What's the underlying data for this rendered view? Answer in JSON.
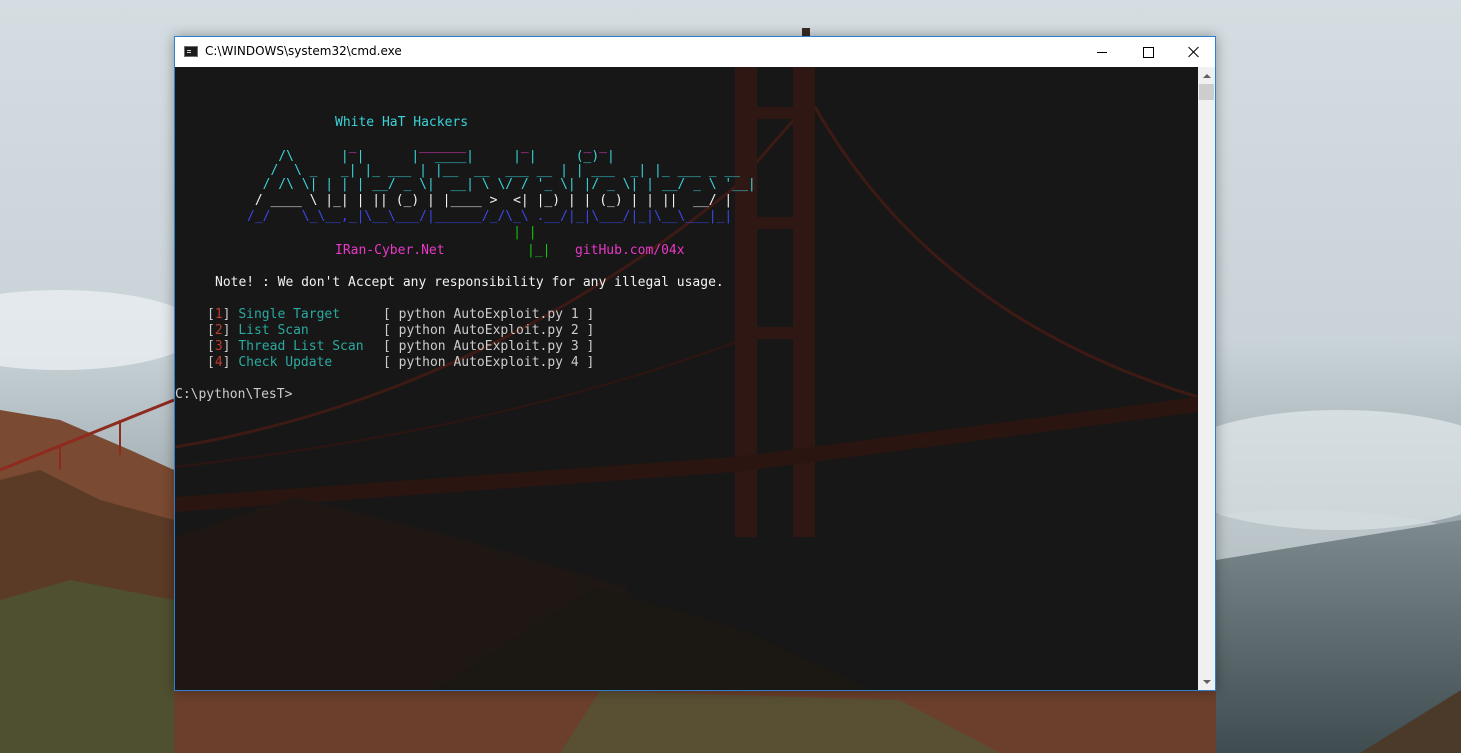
{
  "window": {
    "title": "C:\\WINDOWS\\system32\\cmd.exe",
    "icon": "cmd-icon",
    "controls": [
      "minimize-icon",
      "maximize-icon",
      "close-icon"
    ]
  },
  "console": {
    "header": "White HaT Hackers",
    "banner": [
      "             _        ______       _       _ _",
      "    /\\      | |      |  ____|     | |     (_) |",
      "   /  \\ _   _| |_ ___ | |__  __  ___ __ | | ___  _| |_ ___ _ __",
      "  / /\\ \\| | | | __/ _ \\|  __| \\ \\/ / '_ \\| |/ _ \\| | __/ _ \\ '__|",
      " / ____ \\ |_| | || (_) | |____ >  <| |_) | | (_) | | ||  __/ |",
      "/_/    \\_\\__,_|\\__\\___/|______/_/\\_\\ .__/|_|\\___/|_|\\__\\___|_|",
      "                                  | |",
      "                                  |_|"
    ],
    "site": "IRan-Cyber.Net",
    "pipe": "|_|",
    "github": "gitHub.com/04x",
    "note": "Note! : We don't Accept any responsibility for any illegal usage.",
    "menu": [
      {
        "num": "1",
        "label": "Single Target",
        "command": "[ python AutoExploit.py 1 ]"
      },
      {
        "num": "2",
        "label": "List Scan",
        "command": "[ python AutoExploit.py 2 ]"
      },
      {
        "num": "3",
        "label": "Thread List Scan",
        "command": "[ python AutoExploit.py 3 ]"
      },
      {
        "num": "4",
        "label": "Check Update",
        "command": "[ python AutoExploit.py 4 ]"
      }
    ],
    "prompt": "C:\\python\\TesT>"
  },
  "colors": {
    "header": "#3ad3d8",
    "banner_top": "#ea38c8",
    "banner_mid": "#3ad3d8",
    "banner_low": "#f2f2f2",
    "banner_bottom": "#3a48e8",
    "pipe": "#16c60c",
    "links": "#ea38c8",
    "menu_num": "#c23a2e",
    "menu_label": "#2aa9a0",
    "title_bar_border": "#2d7fd0"
  }
}
